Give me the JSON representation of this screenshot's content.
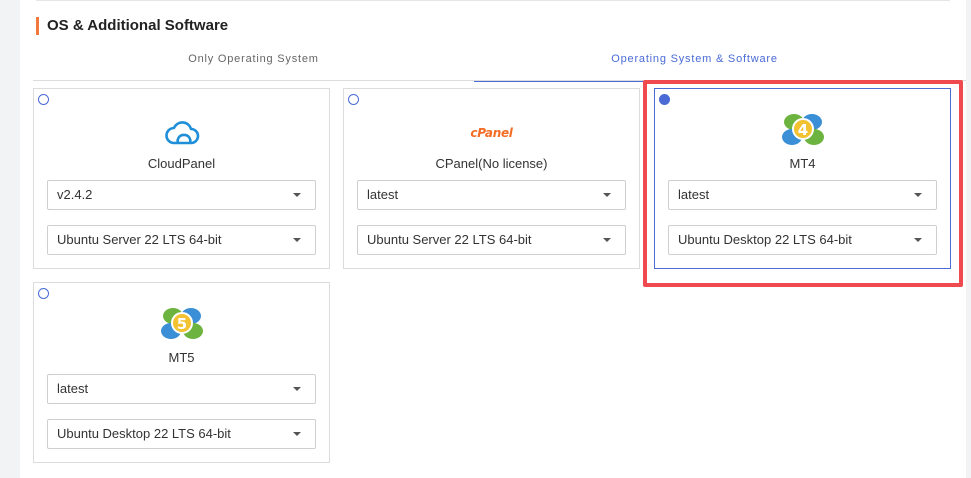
{
  "section": {
    "title": "OS & Additional Software",
    "accent_color": "#f0783c"
  },
  "tabs": [
    {
      "label": "Only Operating System",
      "active": false
    },
    {
      "label": "Operating System & Software",
      "active": true
    }
  ],
  "cards": [
    {
      "name": "CloudPanel",
      "icon": "cloud-icon",
      "logo_text": "",
      "version": "v2.4.2",
      "os": "Ubuntu Server 22 LTS 64-bit",
      "selected": false
    },
    {
      "name": "CPanel(No license)",
      "icon": "cpanel-logo",
      "logo_text": "cPanel",
      "version": "latest",
      "os": "Ubuntu Server 22 LTS 64-bit",
      "selected": false
    },
    {
      "name": "MT4",
      "icon": "mt4-icon",
      "logo_text": "4",
      "version": "latest",
      "os": "Ubuntu Desktop 22 LTS 64-bit",
      "selected": true
    },
    {
      "name": "MT5",
      "icon": "mt5-icon",
      "logo_text": "5",
      "version": "latest",
      "os": "Ubuntu Desktop 22 LTS 64-bit",
      "selected": false
    }
  ],
  "colors": {
    "selected": "#4a6bd6",
    "highlight": "#ee4a4f"
  }
}
